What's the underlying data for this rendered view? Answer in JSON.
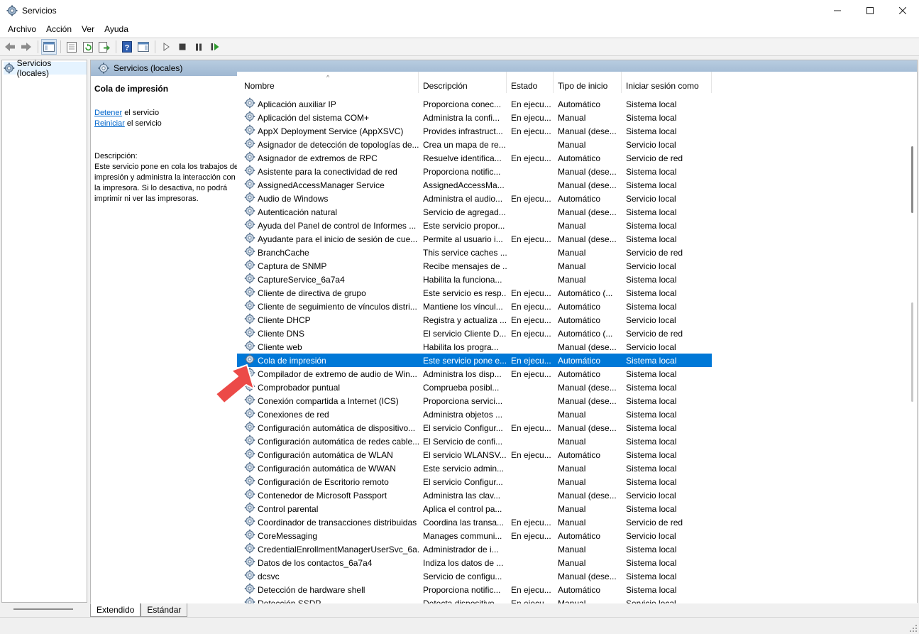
{
  "window": {
    "title": "Servicios"
  },
  "menu": {
    "items": [
      "Archivo",
      "Acción",
      "Ver",
      "Ayuda"
    ]
  },
  "toolbar": {
    "icons": [
      "back-arrow-icon",
      "forward-arrow-icon",
      "show-console-tree-icon",
      "properties-icon",
      "refresh-icon",
      "export-list-icon",
      "help-icon",
      "show-action-pane-icon",
      "start-service-icon",
      "stop-service-icon",
      "pause-service-icon",
      "restart-service-icon"
    ]
  },
  "tree": {
    "selected": "Servicios (locales)"
  },
  "panel": {
    "header": "Servicios (locales)",
    "service_title": "Cola de impresión",
    "link_stop": "Detener",
    "link_stop_suffix": " el servicio",
    "link_restart": "Reiniciar",
    "link_restart_suffix": " el servicio",
    "desc_label": "Descripción:",
    "desc_text": "Este servicio pone en cola los trabajos de impresión y administra la interacción con la impresora. Si lo desactiva, no podrá imprimir ni ver las impresoras."
  },
  "columns": [
    "Nombre",
    "Descripción",
    "Estado",
    "Tipo de inicio",
    "Iniciar sesión como"
  ],
  "selected_row": 19,
  "services": [
    [
      "Aplicación auxiliar IP",
      "Proporciona conec...",
      "En ejecu...",
      "Automático",
      "Sistema local"
    ],
    [
      "Aplicación del sistema COM+",
      "Administra la confi...",
      "En ejecu...",
      "Manual",
      "Sistema local"
    ],
    [
      "AppX Deployment Service (AppXSVC)",
      "Provides infrastruct...",
      "En ejecu...",
      "Manual (dese...",
      "Sistema local"
    ],
    [
      "Asignador de detección de topologías de...",
      "Crea un mapa de re...",
      "",
      "Manual",
      "Servicio local"
    ],
    [
      "Asignador de extremos de RPC",
      "Resuelve identifica...",
      "En ejecu...",
      "Automático",
      "Servicio de red"
    ],
    [
      "Asistente para la conectividad de red",
      "Proporciona notific...",
      "",
      "Manual (dese...",
      "Sistema local"
    ],
    [
      "AssignedAccessManager Service",
      "AssignedAccessMa...",
      "",
      "Manual (dese...",
      "Sistema local"
    ],
    [
      "Audio de Windows",
      "Administra el audio...",
      "En ejecu...",
      "Automático",
      "Servicio local"
    ],
    [
      "Autenticación natural",
      "Servicio de agregad...",
      "",
      "Manual (dese...",
      "Sistema local"
    ],
    [
      "Ayuda del Panel de control de Informes ...",
      "Este servicio propor...",
      "",
      "Manual",
      "Sistema local"
    ],
    [
      "Ayudante para el inicio de sesión de cue...",
      "Permite al usuario i...",
      "En ejecu...",
      "Manual (dese...",
      "Sistema local"
    ],
    [
      "BranchCache",
      "This service caches ...",
      "",
      "Manual",
      "Servicio de red"
    ],
    [
      "Captura de SNMP",
      "Recibe mensajes de ...",
      "",
      "Manual",
      "Servicio local"
    ],
    [
      "CaptureService_6a7a4",
      "Habilita la funciona...",
      "",
      "Manual",
      "Sistema local"
    ],
    [
      "Cliente de directiva de grupo",
      "Este servicio es resp...",
      "En ejecu...",
      "Automático (...",
      "Sistema local"
    ],
    [
      "Cliente de seguimiento de vínculos distri...",
      "Mantiene los víncul...",
      "En ejecu...",
      "Automático",
      "Sistema local"
    ],
    [
      "Cliente DHCP",
      "Registra y actualiza ...",
      "En ejecu...",
      "Automático",
      "Servicio local"
    ],
    [
      "Cliente DNS",
      "El servicio Cliente D...",
      "En ejecu...",
      "Automático (...",
      "Servicio de red"
    ],
    [
      "Cliente web",
      "Habilita los progra...",
      "",
      "Manual (dese...",
      "Servicio local"
    ],
    [
      "Cola de impresión",
      "Este servicio pone e...",
      "En ejecu...",
      "Automático",
      "Sistema local"
    ],
    [
      "Compilador de extremo de audio de Win...",
      "Administra los disp...",
      "En ejecu...",
      "Automático",
      "Sistema local"
    ],
    [
      "Comprobador puntual",
      "Comprueba posibl...",
      "",
      "Manual (dese...",
      "Sistema local"
    ],
    [
      "Conexión compartida a Internet (ICS)",
      "Proporciona servici...",
      "",
      "Manual (dese...",
      "Sistema local"
    ],
    [
      "Conexiones de red",
      "Administra objetos ...",
      "",
      "Manual",
      "Sistema local"
    ],
    [
      "Configuración automática de dispositivo...",
      "El servicio Configur...",
      "En ejecu...",
      "Manual (dese...",
      "Sistema local"
    ],
    [
      "Configuración automática de redes cable...",
      "El Servicio de confi...",
      "",
      "Manual",
      "Sistema local"
    ],
    [
      "Configuración automática de WLAN",
      "El servicio WLANSV...",
      "En ejecu...",
      "Automático",
      "Sistema local"
    ],
    [
      "Configuración automática de WWAN",
      "Este servicio admin...",
      "",
      "Manual",
      "Sistema local"
    ],
    [
      "Configuración de Escritorio remoto",
      "El servicio Configur...",
      "",
      "Manual",
      "Sistema local"
    ],
    [
      "Contenedor de Microsoft Passport",
      "Administra las clav...",
      "",
      "Manual (dese...",
      "Servicio local"
    ],
    [
      "Control parental",
      "Aplica el control pa...",
      "",
      "Manual",
      "Sistema local"
    ],
    [
      "Coordinador de transacciones distribuidas",
      "Coordina las transa...",
      "En ejecu...",
      "Manual",
      "Servicio de red"
    ],
    [
      "CoreMessaging",
      "Manages communi...",
      "En ejecu...",
      "Automático",
      "Servicio local"
    ],
    [
      "CredentialEnrollmentManagerUserSvc_6a...",
      "Administrador de i...",
      "",
      "Manual",
      "Sistema local"
    ],
    [
      "Datos de los contactos_6a7a4",
      "Indiza los datos de ...",
      "",
      "Manual",
      "Sistema local"
    ],
    [
      "dcsvc",
      "Servicio de configu...",
      "",
      "Manual (dese...",
      "Sistema local"
    ],
    [
      "Detección de hardware shell",
      "Proporciona notific...",
      "En ejecu...",
      "Automático",
      "Sistema local"
    ],
    [
      "Detección SSDP",
      "Detecta dispositivo...",
      "En ejecu...",
      "Manual",
      "Servicio local"
    ]
  ],
  "tabs": [
    "Extendido",
    "Estándar"
  ]
}
